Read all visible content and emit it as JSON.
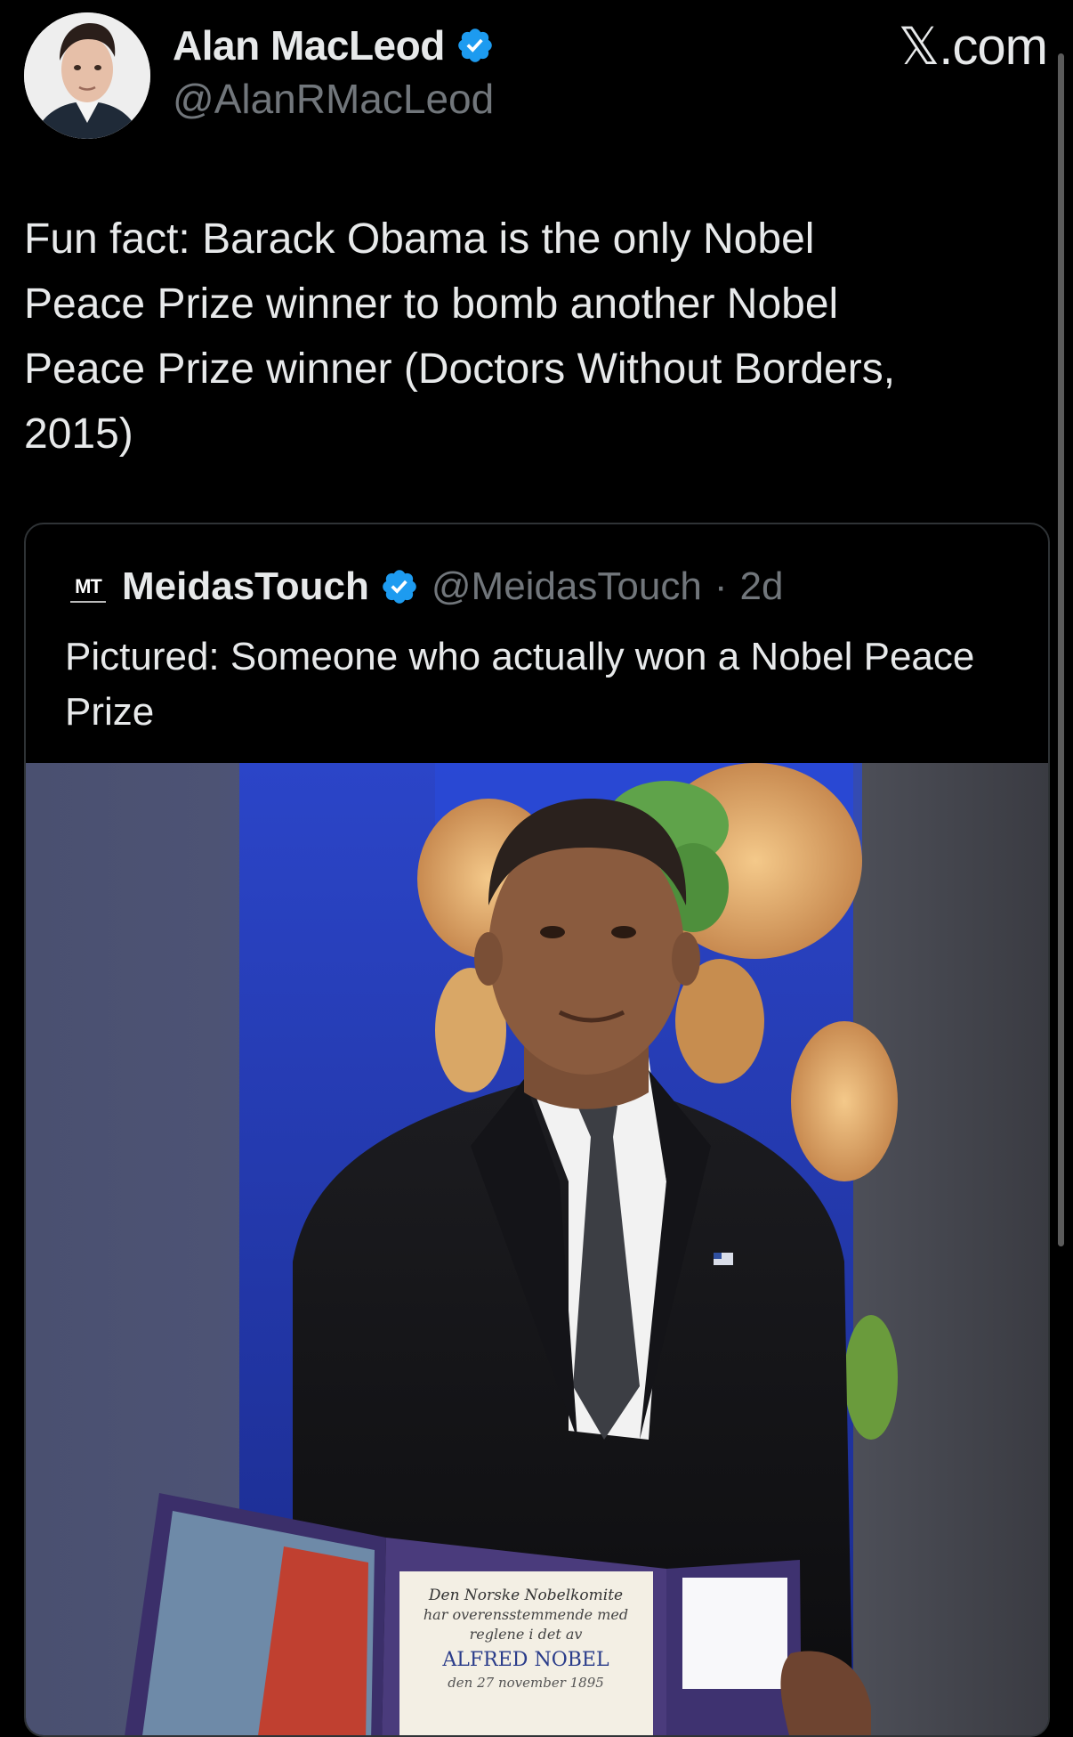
{
  "site": {
    "mark": "𝕏.com"
  },
  "tweet": {
    "author_name": "Alan MacLeod",
    "author_handle": "@AlanRMacLeod",
    "text": "Fun fact: Barack Obama is the only Nobel\nPeace Prize winner to bomb another Nobel\nPeace Prize winner (Doctors Without Borders,\n2015)"
  },
  "quote": {
    "logo_text": "MT",
    "author_name": "MeidasTouch",
    "author_handle": "@MeidasTouch",
    "separator": "·",
    "age": "2d",
    "text": "Pictured: Someone who actually won a Nobel Peace Prize"
  },
  "diploma": {
    "line1": "Den Norske Nobelkomite",
    "line2": "har overensstemmende med",
    "line3": "reglene i det av",
    "line4": "ALFRED NOBEL",
    "line5": "den 27 november 1895"
  },
  "colors": {
    "background": "#000000",
    "text_primary": "#e7e9ea",
    "text_secondary": "#71767b",
    "verified": "#1d9bf0",
    "border": "#2f3336"
  },
  "icons": {
    "verified": "verified-badge-icon",
    "avatar": "profile-avatar",
    "quote_avatar": "meidastouch-logo"
  }
}
